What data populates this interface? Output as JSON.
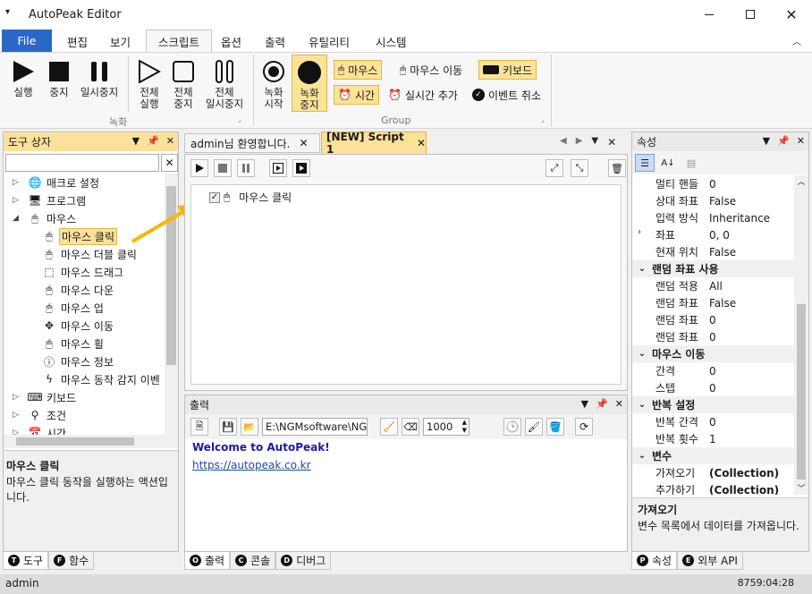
{
  "window": {
    "title": "AutoPeak Editor",
    "status_user": "admin",
    "status_time": "8759:04:28"
  },
  "menu": {
    "file": "File",
    "items": [
      "편집",
      "보기",
      "스크립트",
      "옵션",
      "출력",
      "유틸리티",
      "시스템"
    ]
  },
  "ribbon": {
    "run": "실행",
    "stop": "중지",
    "pause": "일시중지",
    "run_all": "전체\n실행",
    "stop_all": "전체\n중지",
    "pause_all": "전체\n일시중지",
    "rec_start": "녹화\n시작",
    "rec_stop": "녹화\n중지",
    "group_record": "녹화",
    "group_group": "Group",
    "mouse_click": "마우스",
    "mouse_move": "마우스 이동",
    "keyboard": "키보드",
    "time": "시간",
    "realtime_add": "실시간 추가",
    "event_cancel": "이벤트 취소"
  },
  "toolbox": {
    "title": "도구 상자",
    "tree": [
      {
        "label": "매크로 설정",
        "icon": "globe-icon",
        "level": 0,
        "expander": "closed"
      },
      {
        "label": "프로그램",
        "icon": "monitor-icon",
        "level": 0,
        "expander": "closed"
      },
      {
        "label": "마우스",
        "icon": "mouse-icon",
        "level": 0,
        "expander": "open"
      },
      {
        "label": "마우스 클릭",
        "icon": "mouse-click-icon",
        "level": 1,
        "selected": true
      },
      {
        "label": "마우스 더블 클릭",
        "icon": "mouse-double-click-icon",
        "level": 1
      },
      {
        "label": "마우스 드래그",
        "icon": "mouse-drag-icon",
        "level": 1
      },
      {
        "label": "마우스 다운",
        "icon": "mouse-down-icon",
        "level": 1
      },
      {
        "label": "마우스 업",
        "icon": "mouse-up-icon",
        "level": 1
      },
      {
        "label": "마우스 이동",
        "icon": "move-arrows-icon",
        "level": 1
      },
      {
        "label": "마우스 휠",
        "icon": "mouse-wheel-icon",
        "level": 1
      },
      {
        "label": "마우스 정보",
        "icon": "info-icon",
        "level": 1
      },
      {
        "label": "마우스 동작 감지 이벤",
        "icon": "lightning-icon",
        "level": 1
      },
      {
        "label": "키보드",
        "icon": "keyboard-icon",
        "level": 0,
        "expander": "closed"
      },
      {
        "label": "조건",
        "icon": "condition-icon",
        "level": 0,
        "expander": "closed"
      },
      {
        "label": "시간",
        "icon": "calendar-icon",
        "level": 0,
        "expander": "closed"
      }
    ],
    "desc_title": "마우스 클릭",
    "desc_text": "마우스 클릭 동작을 실행하는 액션입니다.",
    "tabs": [
      "도구",
      "함수"
    ],
    "tab_letters": [
      "T",
      "F"
    ]
  },
  "editor": {
    "tabs": [
      "admin님 환영합니다.",
      "[NEW] Script 1"
    ],
    "script_item": "마우스 클릭"
  },
  "output": {
    "title": "출력",
    "path": "E:\\NGMsoftware\\NG",
    "interval": "1000",
    "welcome": "Welcome to AutoPeak!",
    "link": "https://autopeak.co.kr",
    "tabs": [
      "출력",
      "콘솔",
      "디버그"
    ],
    "tab_letters": [
      "O",
      "C",
      "D"
    ]
  },
  "properties": {
    "title": "속성",
    "rows": [
      {
        "k": "멀티 핸들",
        "v": "0"
      },
      {
        "k": "상대 좌표",
        "v": "False"
      },
      {
        "k": "입력 방식",
        "v": "Inheritance"
      },
      {
        "k": "좌표",
        "v": "0, 0",
        "expander": true
      },
      {
        "k": "현재 위치",
        "v": "False"
      },
      {
        "cat": "랜덤 좌표 사용"
      },
      {
        "k": "랜덤 적용",
        "v": "All"
      },
      {
        "k": "랜덤 좌표",
        "v": "False"
      },
      {
        "k": "랜덤 좌표",
        "v": "0"
      },
      {
        "k": "랜덤 좌표",
        "v": "0"
      },
      {
        "cat": "마우스 이동"
      },
      {
        "k": "간격",
        "v": "0"
      },
      {
        "k": "스텝",
        "v": "0"
      },
      {
        "cat": "반복 설정"
      },
      {
        "k": "반복 간격",
        "v": "0"
      },
      {
        "k": "반복 횟수",
        "v": "1"
      },
      {
        "cat": "변수"
      },
      {
        "k": "가져오기",
        "v": "(Collection)",
        "bold": true
      },
      {
        "k": "추가하기",
        "v": "(Collection)",
        "bold": true
      }
    ],
    "desc_title": "가져오기",
    "desc_text": "변수 목록에서 데이터를 가져옵니다.",
    "tabs": [
      "속성",
      "외부 API"
    ],
    "tab_letters": [
      "P",
      "E"
    ]
  }
}
